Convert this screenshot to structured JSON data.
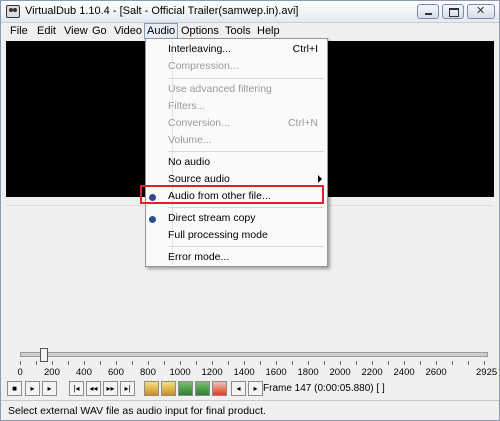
{
  "window": {
    "title": "VirtualDub 1.10.4 - [Salt - Official Trailer(samwep.in).avi]"
  },
  "menubar": {
    "items": [
      "File",
      "Edit",
      "View",
      "Go",
      "Video",
      "Audio",
      "Options",
      "Tools",
      "Help"
    ],
    "active": "Audio"
  },
  "audio_menu": {
    "interleaving": {
      "label": "Interleaving...",
      "accel": "Ctrl+I"
    },
    "compression": {
      "label": "Compression..."
    },
    "use_advanced_filtering": {
      "label": "Use advanced filtering"
    },
    "filters": {
      "label": "Filters..."
    },
    "conversion": {
      "label": "Conversion...",
      "accel": "Ctrl+N"
    },
    "volume": {
      "label": "Volume..."
    },
    "no_audio": {
      "label": "No audio"
    },
    "source_audio": {
      "label": "Source audio"
    },
    "audio_from_other_file": {
      "label": "Audio from other file...",
      "selected": true
    },
    "direct_stream_copy": {
      "label": "Direct stream copy",
      "selected": true
    },
    "full_processing_mode": {
      "label": "Full processing mode"
    },
    "error_mode": {
      "label": "Error mode..."
    }
  },
  "timeline": {
    "ticks": [
      "0",
      "200",
      "400",
      "600",
      "800",
      "1000",
      "1200",
      "1400",
      "1600",
      "1800",
      "2000",
      "2200",
      "2400",
      "2600",
      "2925"
    ],
    "position_frame": 147,
    "max_frame": 2925
  },
  "toolbar": {
    "frame_readout": "Frame 147 (0:00:05.880) [ ]",
    "icons": [
      "stop-icon",
      "play-input-icon",
      "play-output-icon",
      "go-start-icon",
      "step-back-icon",
      "step-forward-icon",
      "go-end-icon",
      "prev-keyframe-icon",
      "next-keyframe-icon",
      "prev-scene-icon",
      "next-scene-icon",
      "prev-drop-icon",
      "mark-in-icon",
      "mark-out-icon"
    ]
  },
  "status": {
    "text": "Select external WAV file as audio input for final product."
  },
  "colors": {
    "highlight_box": "#e0202a",
    "video_background": "#000000",
    "radio_bullet": "#2c4f8a"
  }
}
